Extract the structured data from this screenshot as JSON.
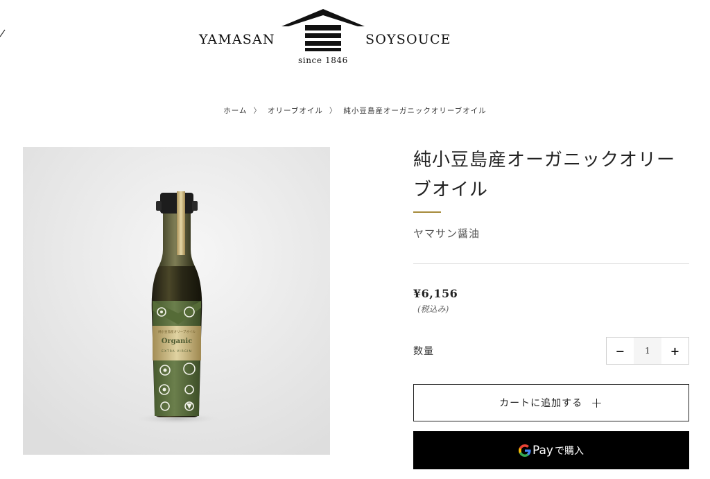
{
  "header": {
    "brand_left": "YAMASAN",
    "brand_right": "SOYSOUCE",
    "since": "since 1846"
  },
  "breadcrumb": [
    {
      "label": "ホーム"
    },
    {
      "label": "オリーブオイル"
    },
    {
      "label": "純小豆島産オーガニックオリーブオイル"
    }
  ],
  "product": {
    "title": "純小豆島産オーガニックオリーブオイル",
    "vendor": "ヤマサン醤油",
    "price": "¥6,156",
    "tax_note": "(税込み)",
    "quantity_label": "数量",
    "quantity": "1",
    "qty_minus": "−",
    "qty_plus": "+",
    "add_to_cart": "カートに追加する",
    "add_to_cart_icon": "+",
    "gpay_label": "Pay",
    "gpay_suffix": "で購入",
    "label_organic": "Organic",
    "label_grade": "EXTRA VIRGIN"
  },
  "colors": {
    "accent_gold": "#a68a3a",
    "button_black": "#000000",
    "label_green": "#5a7040"
  }
}
